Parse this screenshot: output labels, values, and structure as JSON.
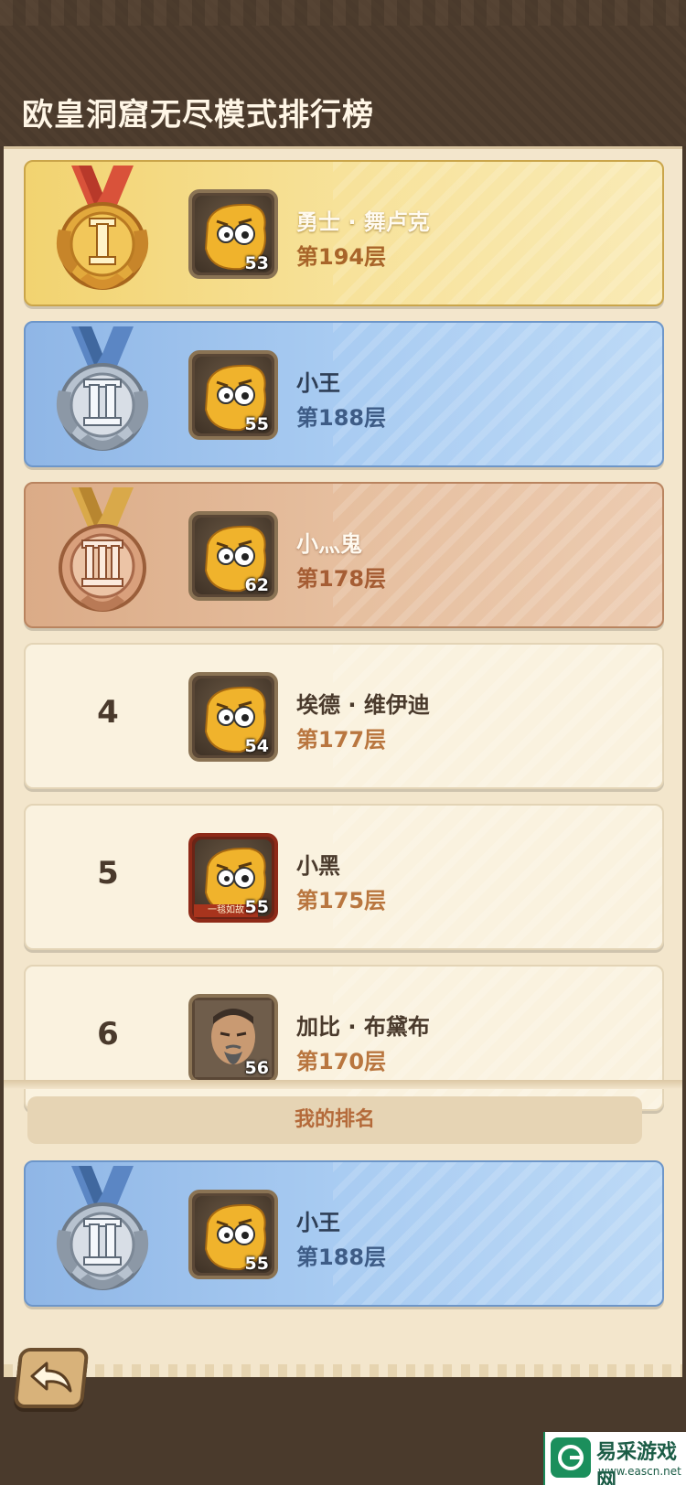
{
  "page": {
    "title": "欧皇洞窟无尽模式排行榜"
  },
  "leaderboard": {
    "rows": [
      {
        "rank": "1",
        "tier": "gold",
        "name": "勇士 · 舞卢克",
        "floor": "第194层",
        "level": "53",
        "avatar_icon": "yellow-creature-icon"
      },
      {
        "rank": "2",
        "tier": "silver",
        "name": "小王",
        "floor": "第188层",
        "level": "55",
        "avatar_icon": "yellow-creature-icon"
      },
      {
        "rank": "3",
        "tier": "bronze",
        "name": "小灬鬼",
        "floor": "第178层",
        "level": "62",
        "avatar_icon": "yellow-creature-icon"
      },
      {
        "rank": "4",
        "tier": "plain",
        "name": "埃德 · 维伊迪",
        "floor": "第177层",
        "level": "54",
        "avatar_icon": "yellow-creature-icon"
      },
      {
        "rank": "5",
        "tier": "plain",
        "name": "小黑",
        "floor": "第175层",
        "level": "55",
        "avatar_icon": "yellow-creature-icon",
        "avatar_banner": "一毯如故"
      },
      {
        "rank": "6",
        "tier": "plain",
        "name": "加比 · 布黛布",
        "floor": "第170层",
        "level": "56",
        "avatar_icon": "old-man-icon"
      }
    ]
  },
  "my_rank": {
    "label": "我的排名",
    "rank": "2",
    "tier": "silver",
    "name": "小王",
    "floor": "第188层",
    "level": "55",
    "avatar_icon": "yellow-creature-icon"
  },
  "navigation": {
    "back_icon": "back-arrow-icon"
  },
  "watermark": {
    "title": "易采游戏网",
    "url": "www.eascn.net"
  },
  "colors": {
    "gold": "#f2d370",
    "silver": "#8fb6e6",
    "bronze": "#dbab87",
    "plain": "#faf2df",
    "background": "#4a3a2c"
  }
}
